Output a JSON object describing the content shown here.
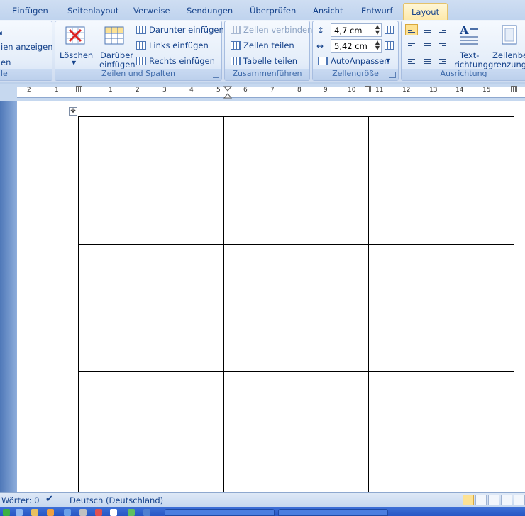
{
  "tabs": [
    "Einfügen",
    "Seitenlayout",
    "Verweise",
    "Sendungen",
    "Überprüfen",
    "Ansicht",
    "Entwurf",
    "Layout"
  ],
  "ribbon": {
    "tabelle_group": {
      "items": [
        "ien anzeigen",
        "en"
      ],
      "label": "le"
    },
    "zeilen_spalten": {
      "loeschen": "Löschen",
      "darueber": [
        "Darüber",
        "einfügen"
      ],
      "darunter": "Darunter einfügen",
      "links": "Links einfügen",
      "rechts": "Rechts einfügen",
      "label": "Zeilen und Spalten"
    },
    "zusammenfuehren": {
      "verbinden": "Zellen verbinden",
      "teilen": "Zellen teilen",
      "tabelle_teilen": "Tabelle teilen",
      "label": "Zusammenführen"
    },
    "zellengroesse": {
      "height": "4,7 cm",
      "width": "5,42 cm",
      "autoanpassen": "AutoAnpassen",
      "label": "Zellengröße"
    },
    "ausrichtung": {
      "textrichtung": [
        "Text-",
        "richtung"
      ],
      "zellenbegrenzung": [
        "Zellenbe-",
        "grenzunge"
      ],
      "label": "Ausrichtung"
    }
  },
  "ruler": {
    "numbers": [
      "2",
      "1",
      "1",
      "2",
      "3",
      "4",
      "5",
      "6",
      "7",
      "8",
      "9",
      "10",
      "11",
      "12",
      "13",
      "14",
      "15"
    ]
  },
  "table": {
    "rows": 3,
    "cols": 3
  },
  "statusbar": {
    "words": "Wörter: 0",
    "language": "Deutsch (Deutschland)"
  }
}
